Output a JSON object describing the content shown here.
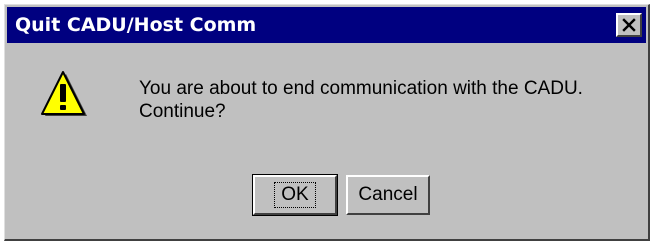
{
  "window": {
    "title": "Quit CADU/Host Comm",
    "close_icon": "close-icon"
  },
  "dialog": {
    "icon": "warning-icon",
    "message_line1": "You are about to end communication with the CADU.",
    "message_line2": "Continue?"
  },
  "buttons": {
    "ok_label": "OK",
    "cancel_label": "Cancel"
  },
  "colors": {
    "titlebar": "#000080",
    "face": "#c0c0c0",
    "warning": "#ffff00"
  }
}
